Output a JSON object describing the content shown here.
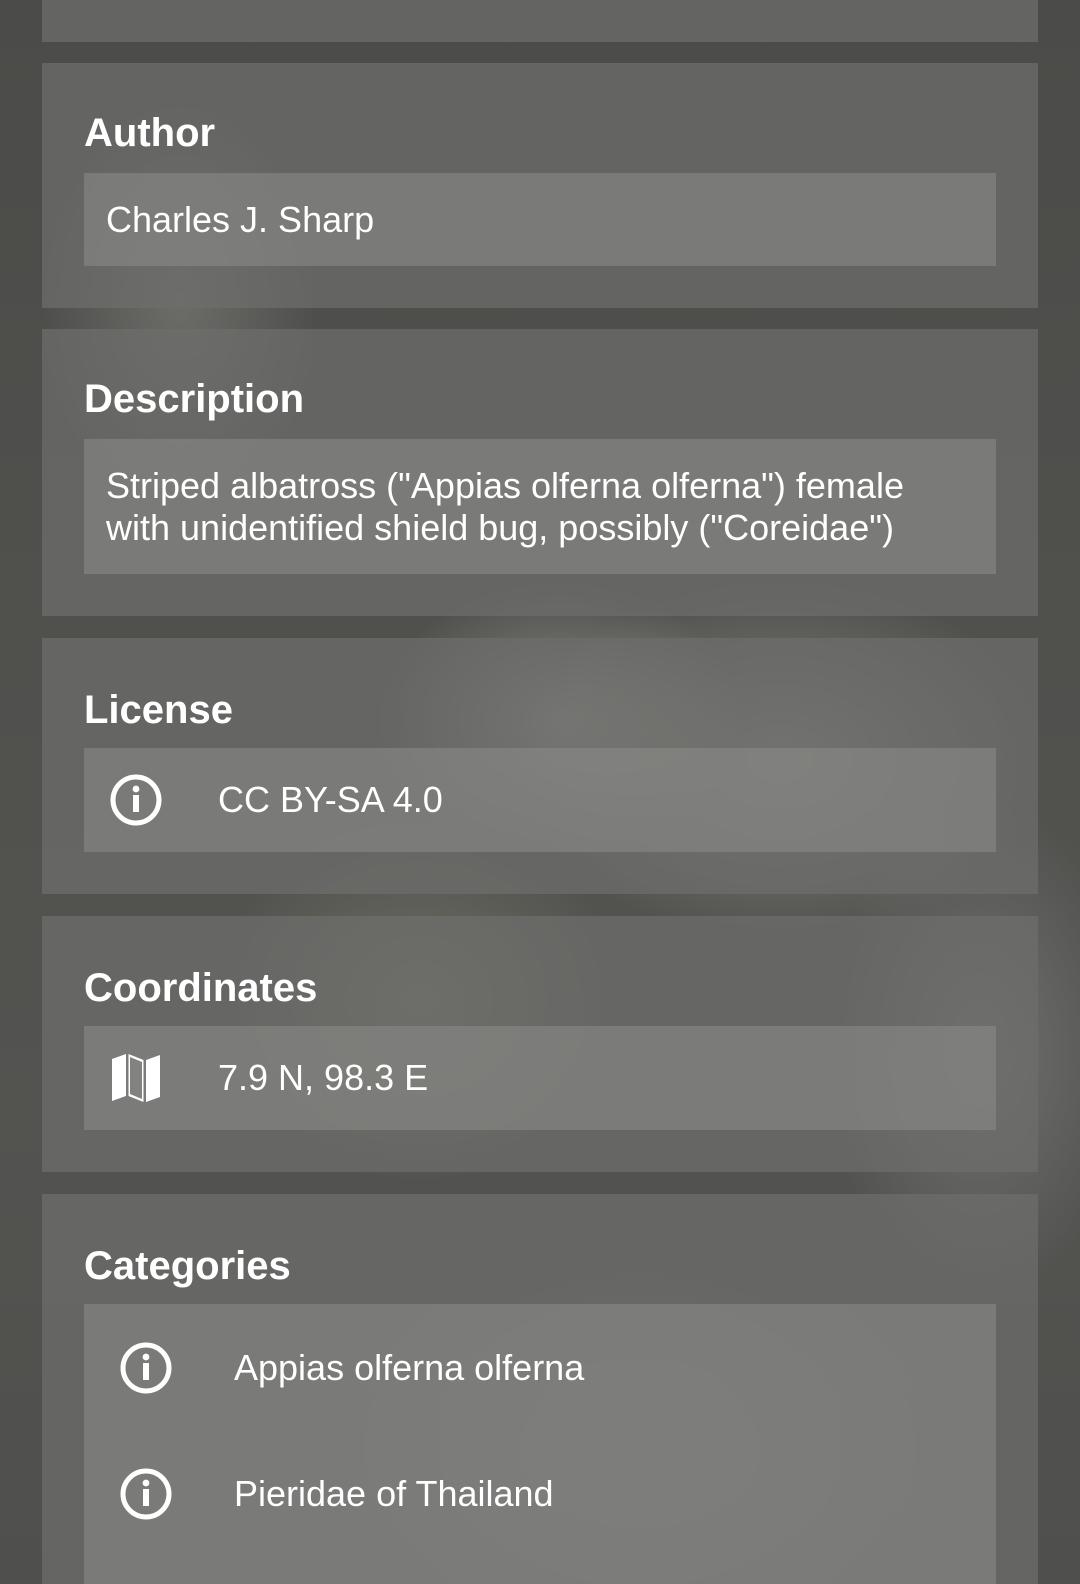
{
  "author": {
    "title": "Author",
    "value": "Charles J. Sharp"
  },
  "description": {
    "title": "Description",
    "value": "Striped albatross (\"Appias olferna olferna\") female with unidentified shield bug, possibly (\"Coreidae\")"
  },
  "license": {
    "title": "License",
    "icon": "info-icon",
    "value": "CC BY-SA 4.0"
  },
  "coordinates": {
    "title": "Coordinates",
    "icon": "map-icon",
    "value": "7.9 N, 98.3 E"
  },
  "categories": {
    "title": "Categories",
    "items": [
      {
        "icon": "info-icon",
        "label": "Appias olferna olferna"
      },
      {
        "icon": "info-icon",
        "label": "Pieridae of Thailand"
      }
    ]
  }
}
